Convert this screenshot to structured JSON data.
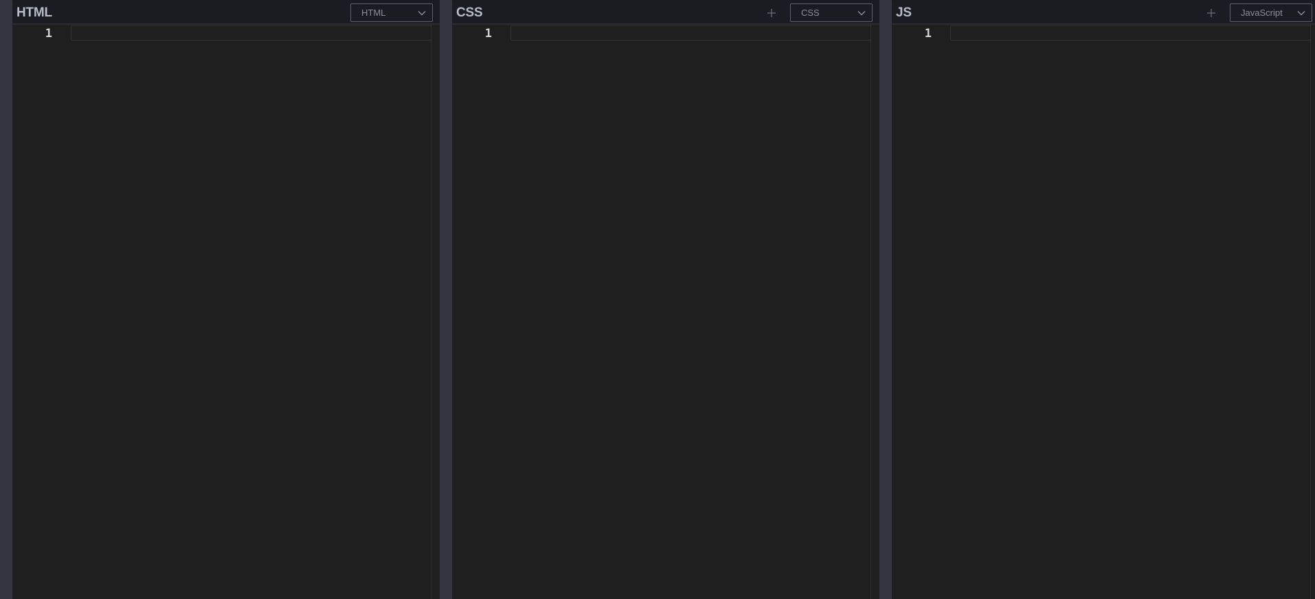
{
  "panes": [
    {
      "title": "HTML",
      "show_add": false,
      "selector": {
        "selected": "HTML"
      },
      "editor": {
        "line_numbers": [
          "1"
        ]
      }
    },
    {
      "title": "CSS",
      "show_add": true,
      "selector": {
        "selected": "CSS"
      },
      "editor": {
        "line_numbers": [
          "1"
        ]
      }
    },
    {
      "title": "JS",
      "show_add": true,
      "selector": {
        "selected": "JavaScript"
      },
      "editor": {
        "line_numbers": [
          "1"
        ]
      }
    }
  ],
  "icons": {
    "add": "plus-icon",
    "dropdown": "chevron-down-icon"
  },
  "colors": {
    "background": "#1e1e1e",
    "header": "#1b1c22",
    "gutter": "#343541",
    "title_text": "#b7bccb",
    "select_border": "#5d6070"
  }
}
